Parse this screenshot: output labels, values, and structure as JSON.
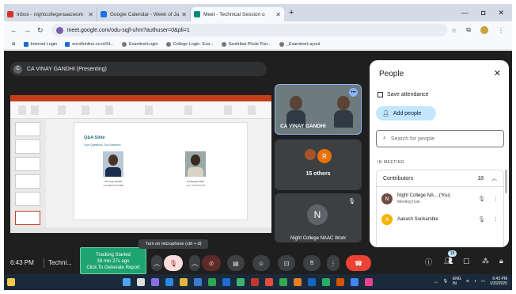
{
  "browser": {
    "tabs": [
      {
        "label": "Inbox - nightcollegenaacwork",
        "icon_color": "#d93025"
      },
      {
        "label": "Google Calendar - Week of Ja",
        "icon_color": "#1a73e8"
      },
      {
        "label": "Meet - Technical Session o",
        "icon_color": "#00897b"
      }
    ],
    "new_tab": "+",
    "url": "meet.google.com/odu-sqjf-uhm?authuser=0&pli=1",
    "bookmarks": [
      "Internet Login",
      "enrollonline.co.in/St...",
      "ExaminerLogin",
      "College Login- Exa...",
      "Savitribai Phule Pun...",
      "_ExaminerLayout"
    ]
  },
  "meet": {
    "presenter_initials": "C",
    "presenter_label": "CA VINAY GANDHI (Presenting)",
    "slide": {
      "title": "Q&A Slide",
      "subtitle": "Your Questions, Our Answers!",
      "people": [
        {
          "name": "CA Vinay Gandhi",
          "phone": "+91 98XXXXX7980"
        },
        {
          "name": "CA Megha Shah",
          "phone": "+91 77XXXXX716"
        }
      ]
    },
    "tiles": {
      "camera_name": "CA VINAY GANDHI",
      "others_initial": "R",
      "others_label": "15 others",
      "nc_initial": "N",
      "nc_name": "Night College NAAC Work"
    },
    "panel": {
      "title": "People",
      "save_attendance": "Save attendance",
      "add_people": "Add people",
      "search_placeholder": "Search for people",
      "in_meeting": "IN MEETING",
      "contributors_label": "Contributors",
      "contributors_count": "18",
      "participants": [
        {
          "initial": "N",
          "name": "Night College NA... (You)",
          "role": "Meeting host",
          "color": "#6d4c41"
        },
        {
          "initial": "A",
          "name": "Aakash Sonkamble",
          "role": "",
          "color": "#f4b400"
        }
      ]
    },
    "controls": {
      "time": "6:43 PM",
      "meeting_title": "Techni...",
      "tracking_line1": "Tracking Started",
      "tracking_line2": "39 min 27s ago",
      "tracking_line3": "Click To Generate Report",
      "mic_tooltip": "Turn on microphone (ctrl + d)",
      "people_badge": "18"
    }
  },
  "taskbar": {
    "lang": "ENG",
    "lang2": "IN",
    "time": "6:43 PM",
    "date": "1/20/2025"
  }
}
